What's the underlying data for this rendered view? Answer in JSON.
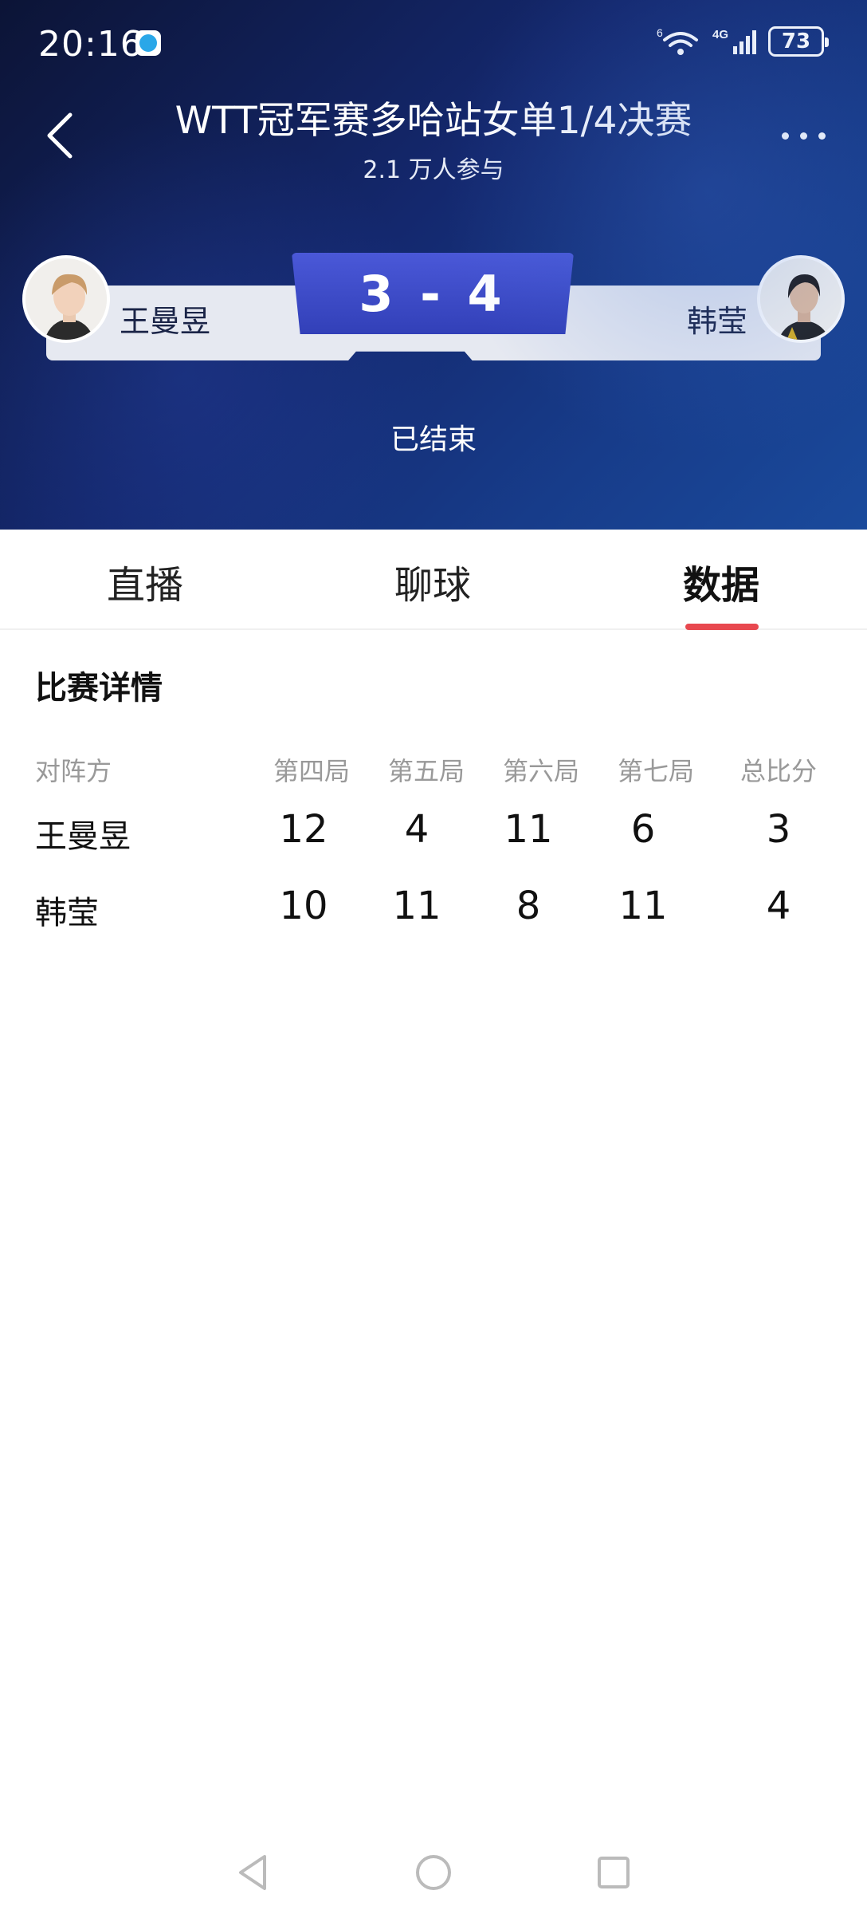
{
  "status_bar": {
    "time": "20:16",
    "battery": "73",
    "network": "4G",
    "wifi_badge": "6"
  },
  "header": {
    "title": "WTT冠军赛多哈站女单1/4决赛",
    "subtitle": "2.1 万人参与",
    "back_icon": "chevron-left-icon",
    "more_icon": "more-dots-icon"
  },
  "match": {
    "score": "3 - 4",
    "player_left": "王曼昱",
    "player_right": "韩莹",
    "status": "已结束"
  },
  "tabs": [
    {
      "label": "直播",
      "active": false
    },
    {
      "label": "聊球",
      "active": false
    },
    {
      "label": "数据",
      "active": true
    }
  ],
  "details": {
    "section_title": "比赛详情",
    "columns": [
      "对阵方",
      "第四局",
      "第五局",
      "第六局",
      "第七局",
      "总比分"
    ],
    "rows": [
      {
        "name": "王曼昱",
        "scores": [
          "12",
          "4",
          "11",
          "6"
        ],
        "total": "3"
      },
      {
        "name": "韩莹",
        "scores": [
          "10",
          "11",
          "8",
          "11"
        ],
        "total": "4"
      }
    ]
  },
  "colors": {
    "header_bg": "#14286e",
    "score_box": "#3a48c4",
    "tab_indicator": "#e8484f"
  }
}
